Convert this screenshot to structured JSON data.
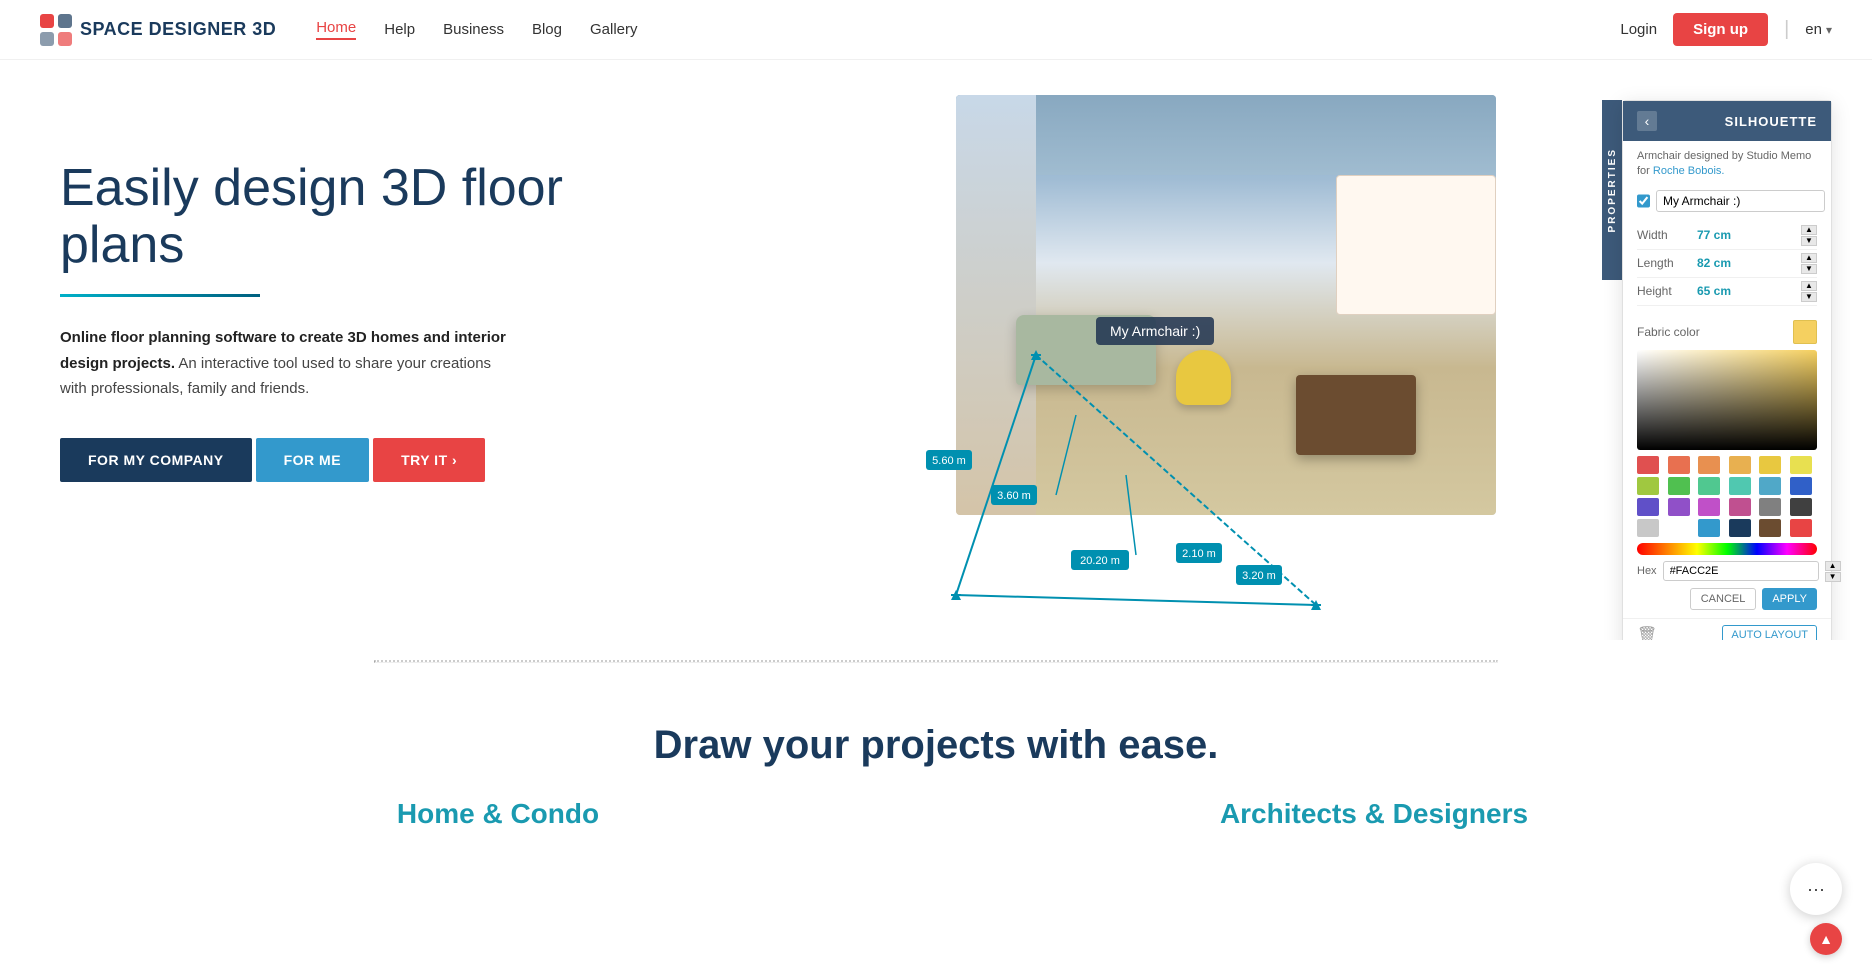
{
  "brand": {
    "name": "SPACE DESIGNER 3D",
    "logo_alt": "Space Designer 3D logo"
  },
  "nav": {
    "links": [
      {
        "label": "Home",
        "active": true
      },
      {
        "label": "Help",
        "active": false
      },
      {
        "label": "Business",
        "active": false
      },
      {
        "label": "Blog",
        "active": false
      },
      {
        "label": "Gallery",
        "active": false
      }
    ],
    "login_label": "Login",
    "signup_label": "Sign up",
    "lang": "en"
  },
  "hero": {
    "title": "Easily design 3D floor plans",
    "description_bold": "Online floor planning software to create 3D homes and interior design projects.",
    "description_rest": " An interactive tool used to share your creations with professionals, family and friends.",
    "btn_company": "FOR MY COMPANY",
    "btn_me": "FOR ME",
    "btn_try": "TRY IT ›"
  },
  "armchair_label": "My Armchair :)",
  "properties_panel": {
    "title": "SILHOUETTE",
    "subtitle": "Armchair designed by Studio Memo for",
    "link_text": "Roche Bobois.",
    "properties_tab": "PROPERTIES",
    "name_value": "My Armchair :)",
    "width_label": "Width",
    "width_value": "77 cm",
    "length_label": "Length",
    "length_value": "82 cm",
    "height_label": "Height",
    "height_value": "65 cm",
    "fabric_label": "Fabric color",
    "hex_label": "Hex",
    "hex_value": "#FACC2E",
    "cancel_label": "CANCEL",
    "apply_label": "APPLY",
    "auto_layout_label": "AUTO LAYOUT"
  },
  "color_swatches": [
    "#e05050",
    "#e87050",
    "#e89050",
    "#e8b050",
    "#e8c840",
    "#e8e050",
    "#a0c840",
    "#50c050",
    "#50c890",
    "#50c8b0",
    "#50a8c8",
    "#3060c8",
    "#6050c8",
    "#9050c8",
    "#c050c8",
    "#c05090",
    "#808080",
    "#404040",
    "#c8c8c8",
    "#ffffff",
    "#3399cc",
    "#1a3a5c",
    "#6b4c30",
    "#e84444"
  ],
  "separator": "...........................................................................",
  "bottom_section": {
    "title": "Draw your projects with ease.",
    "col1_title": "Home & Condo",
    "col1_sub": "",
    "col2_title": "Architects & Designers",
    "col2_sub": ""
  },
  "chat_icon": "···",
  "scroll_top_icon": "▲"
}
